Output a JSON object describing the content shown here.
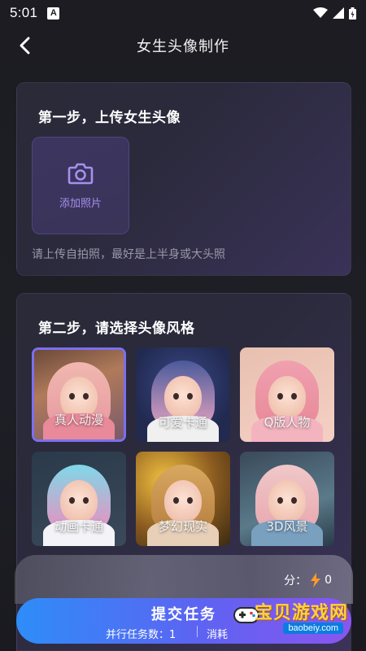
{
  "status_bar": {
    "time": "5:01"
  },
  "nav": {
    "title": "女生头像制作"
  },
  "step1": {
    "title": "第一步，上传女生头像",
    "upload_label": "添加照片",
    "hint": "请上传自拍照，最好是上半身或大头照"
  },
  "step2": {
    "title": "第二步，请选择头像风格",
    "styles": [
      {
        "label": "真人动漫",
        "selected": true
      },
      {
        "label": "可爱卡通",
        "selected": false
      },
      {
        "label": "Q版人物",
        "selected": false
      },
      {
        "label": "动画卡通",
        "selected": false
      },
      {
        "label": "梦幻现实",
        "selected": false
      },
      {
        "label": "3D风景",
        "selected": false
      }
    ]
  },
  "bottom": {
    "points_label": "分：",
    "points_value": "0",
    "submit_label": "提交任务",
    "parallel_tasks": "并行任务数：1",
    "cost_label": "消耗"
  },
  "watermark": {
    "text": "宝贝游戏网",
    "url": "baobeiy.com"
  },
  "colors": {
    "accent": "#7d6ff0",
    "upload_text": "#a690ee",
    "submit_gradient_start": "#2e8df8",
    "submit_gradient_end": "#8a55ef"
  }
}
